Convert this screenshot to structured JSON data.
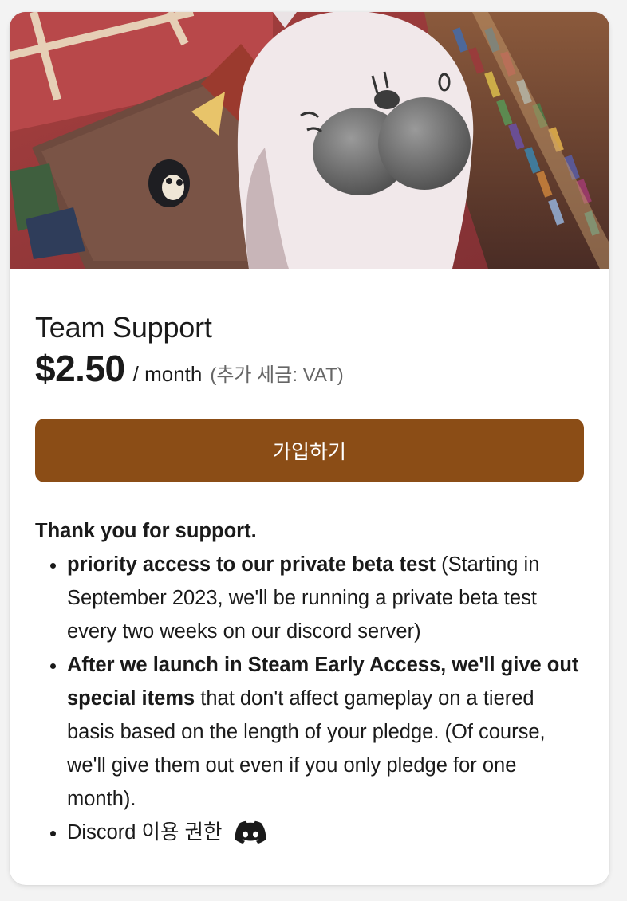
{
  "tier": {
    "title": "Team Support",
    "price": "$2.50",
    "period": "/ month",
    "tax_note": "(추가 세금: VAT)",
    "join_label": "가입하기"
  },
  "description": {
    "intro": "Thank you for support.",
    "benefits": [
      {
        "bold": "priority access to our private beta test",
        "text": " (Starting in September 2023, we'll be running a private beta test every two weeks on our discord server)"
      },
      {
        "bold": "After we launch in Steam Early Access, we'll give out special items",
        "text": " that don't affect gameplay on a tiered basis based on the length of your pledge. (Of course, we'll give them out even if you only pledge for one month)."
      },
      {
        "bold": "",
        "text": "Discord 이용 권한",
        "icon": "discord-icon"
      }
    ]
  },
  "colors": {
    "button_bg": "#8b4d16",
    "page_bg": "#f3f3f3"
  }
}
